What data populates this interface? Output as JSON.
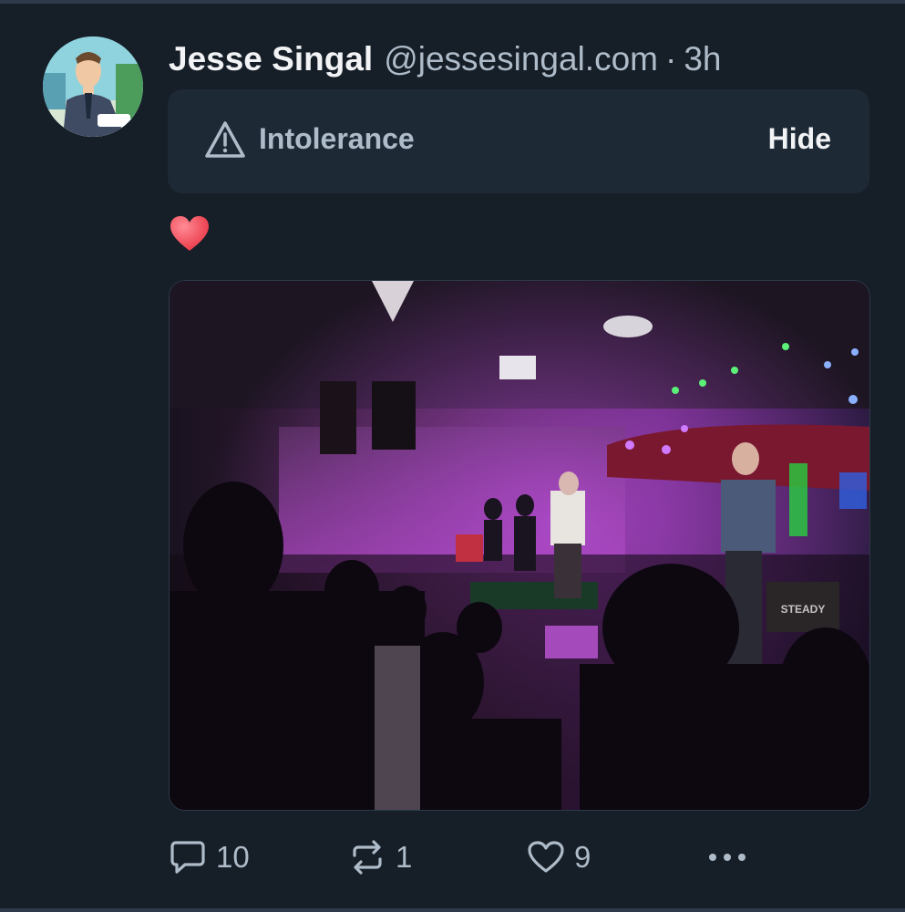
{
  "post": {
    "author_name": "Jesse Singal",
    "author_handle": "@jessesingal.com",
    "separator": "·",
    "time": "3h",
    "content_warning": {
      "icon": "warning-triangle-icon",
      "label": "Intolerance",
      "action_label": "Hide"
    },
    "body_emoji": "heart-emoji",
    "image": {
      "kind": "concert-photo",
      "visible_text": "STEADY"
    }
  },
  "actions": {
    "reply_count": "10",
    "repost_count": "1",
    "like_count": "9",
    "more_icon": "ellipsis-icon"
  },
  "colors": {
    "background": "#161e27",
    "warning_bg": "#1e2936",
    "muted_text": "#aebbc9",
    "heart": "#f24b5a"
  }
}
